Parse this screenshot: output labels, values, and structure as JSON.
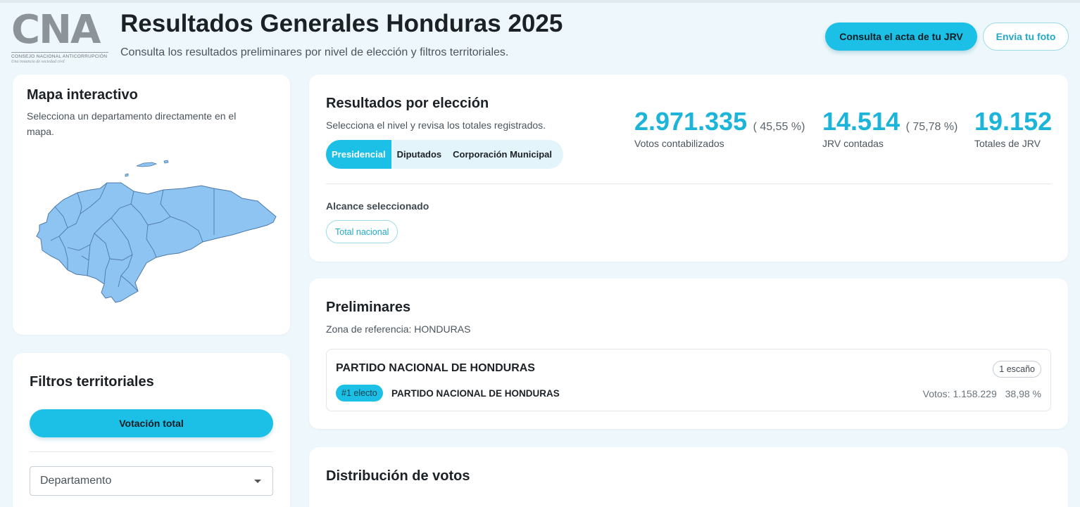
{
  "header": {
    "logo_letters": "CNA",
    "logo_subtitle": "CONSEJO NACIONAL ANTICORRUPCIÓN",
    "logo_tagline": "Una instancia de sociedad civil",
    "title": "Resultados Generales Honduras 2025",
    "subtitle": "Consulta los resultados preliminares por nivel de elección y filtros territoriales.",
    "btn_acta": "Consulta el acta de tu JRV",
    "btn_foto": "Envia tu foto"
  },
  "map": {
    "title": "Mapa interactivo",
    "description": "Selecciona un departamento directamente en el mapa.",
    "fill_color": "#8ec4f2",
    "stroke_color": "#4d79a8"
  },
  "filters": {
    "title": "Filtros territoriales",
    "btn_total": "Votación total",
    "department_select": "Departamento"
  },
  "results": {
    "title": "Resultados por elección",
    "description": "Selecciona el nivel y revisa los totales registrados.",
    "tabs": [
      {
        "label": "Presidencial",
        "active": true
      },
      {
        "label": "Diputados",
        "active": false
      },
      {
        "label": "Corporación Municipal",
        "active": false
      }
    ],
    "stats": [
      {
        "value": "2.971.335",
        "pct": "( 45,55 %)",
        "label": "Votos contabilizados"
      },
      {
        "value": "14.514",
        "pct": "( 75,78 %)",
        "label": "JRV contadas"
      },
      {
        "value": "19.152",
        "pct": "",
        "label": "Totales de JRV"
      }
    ],
    "scope_label": "Alcance seleccionado",
    "scope_value": "Total nacional"
  },
  "preliminares": {
    "title": "Preliminares",
    "zone": "Zona de referencia: HONDURAS",
    "party": {
      "name": "PARTIDO NACIONAL DE HONDURAS",
      "seats": "1 escaño",
      "elect_badge": "#1 electo",
      "candidate": "PARTIDO NACIONAL DE HONDURAS",
      "votes": "Votos: 1.158.229",
      "pct": "38,98 %"
    }
  },
  "distribution": {
    "title": "Distribución de votos"
  },
  "colors": {
    "accent": "#1cc0e6",
    "accent_text": "#1cb4d8",
    "background": "#eef7fb"
  }
}
